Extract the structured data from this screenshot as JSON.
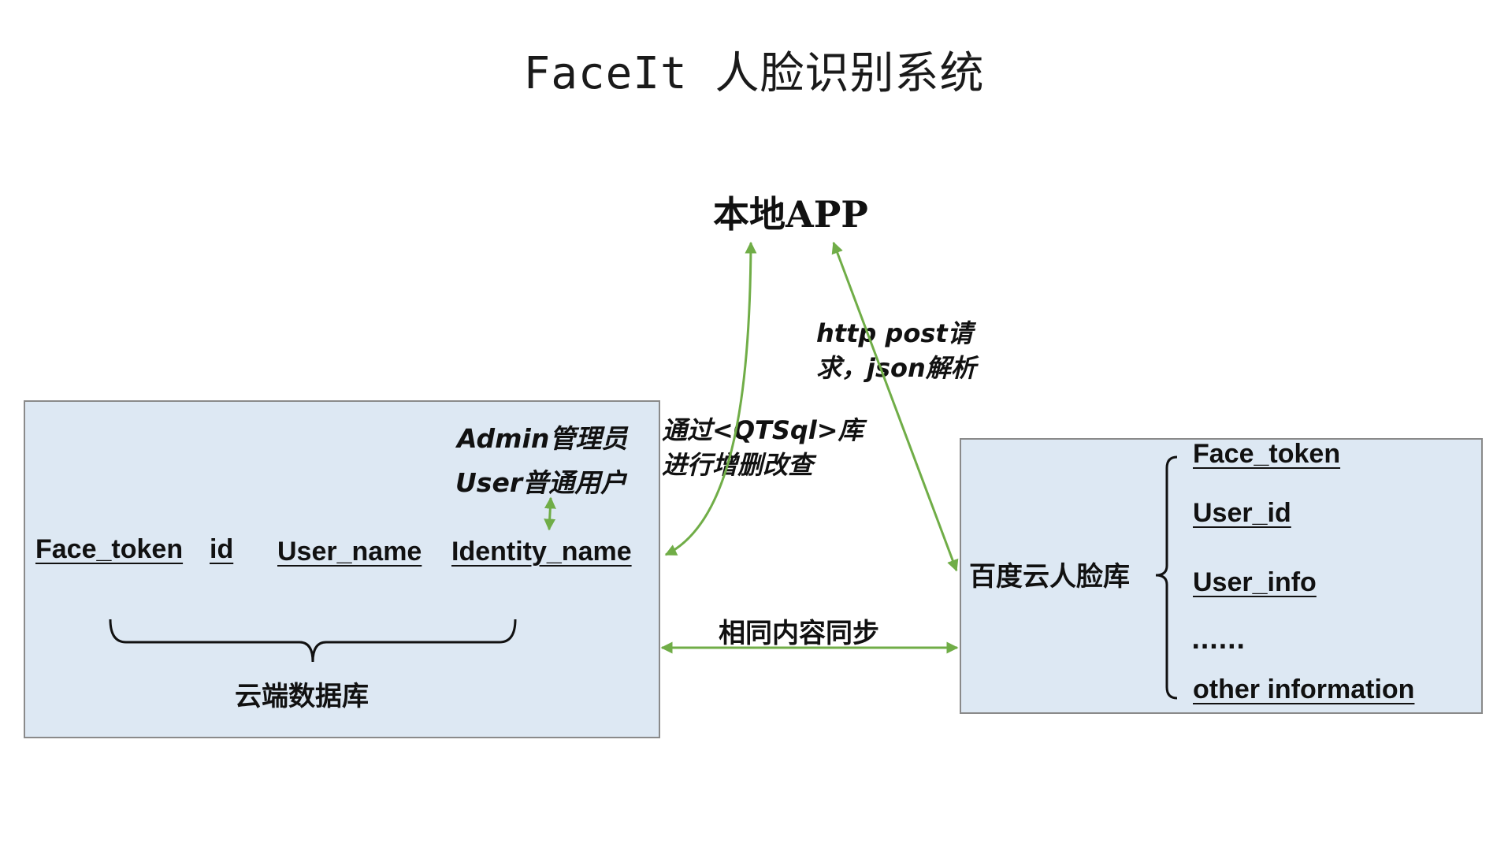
{
  "title": "FaceIt 人脸识别系统",
  "app": {
    "label": "本地APP"
  },
  "local_db": {
    "fields": [
      "Face_token",
      "id",
      "User_name",
      "Identity_name"
    ],
    "roles": [
      "Admin管理员",
      "User普通用户"
    ],
    "label": "云端数据库"
  },
  "baidu_db": {
    "label": "百度云人脸库",
    "fields": [
      "Face_token",
      "User_id",
      "User_info",
      "......",
      "other information"
    ]
  },
  "edges": {
    "qtsql": [
      "通过<QTSql>库",
      "进行增删改查"
    ],
    "http": [
      "http post请",
      "求，json解析"
    ],
    "sync": "相同内容同步"
  },
  "colors": {
    "panel_fill": "#dde8f3",
    "panel_border": "#8a8a8a",
    "arrow": "#70ad47"
  }
}
